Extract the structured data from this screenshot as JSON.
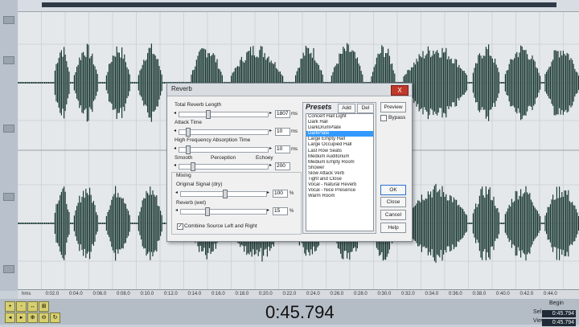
{
  "timeline": {
    "ticks": [
      "hms",
      "0:02.0",
      "0:04.0",
      "0:06.0",
      "0:08.0",
      "0:10.0",
      "0:12.0",
      "0:14.0",
      "0:16.0",
      "0:18.0",
      "0:20.0",
      "0:22.0",
      "0:24.0",
      "0:26.0",
      "0:28.0",
      "0:30.0",
      "0:32.0",
      "0:34.0",
      "0:36.0",
      "0:38.0",
      "0:40.0",
      "0:42.0",
      "0:44.0"
    ]
  },
  "time_display": "0:45.794",
  "begin_panel": {
    "begin_label": "Begin",
    "sel_label": "Sel",
    "view_label": "View",
    "sel_value": "0:45.794",
    "view_value": "0:45.794"
  },
  "dialog": {
    "title": "Reverb",
    "close_label": "X",
    "params": {
      "total_reverb_length": {
        "label": "Total Reverb Length",
        "value": "1807",
        "unit": "ms"
      },
      "attack_time": {
        "label": "Attack Time",
        "value": "10",
        "unit": "ms"
      },
      "hf_absorption": {
        "label": "High Frequency Absorption Time",
        "value": "10",
        "unit": "ms"
      },
      "perception": {
        "label_left": "Smooth",
        "label_mid": "Perception",
        "label_right": "Echoey",
        "value": "200"
      }
    },
    "mixing": {
      "title": "Mixing",
      "original_signal": {
        "label": "Original Signal (dry)",
        "value": "100",
        "unit": "%"
      },
      "reverb_wet": {
        "label": "Reverb (wet)",
        "value": "15",
        "unit": "%"
      },
      "combine_label": "Combine Source Left and Right",
      "combine_checked": true
    },
    "presets": {
      "title": "Presets",
      "add_label": "Add",
      "del_label": "Del",
      "selected": "DarkPlate",
      "items": [
        "Concert Hall Light",
        "Dark Hall",
        "DarkDrumPlate",
        "DarkPlate",
        "Large Empty Hall",
        "Large Occupied Hall",
        "Last Row Seats",
        "Medium Auditorium",
        "Medium Empty Room",
        "Shower",
        "Slow Attack Verb",
        "Tight and Close",
        "Vocal - Natural Reverb",
        "Vocal - Nice Presence",
        "Warm Room"
      ]
    },
    "buttons": {
      "preview": "Preview",
      "bypass": "Bypass",
      "ok": "OK",
      "close": "Close",
      "cancel": "Cancel",
      "help": "Help"
    }
  }
}
